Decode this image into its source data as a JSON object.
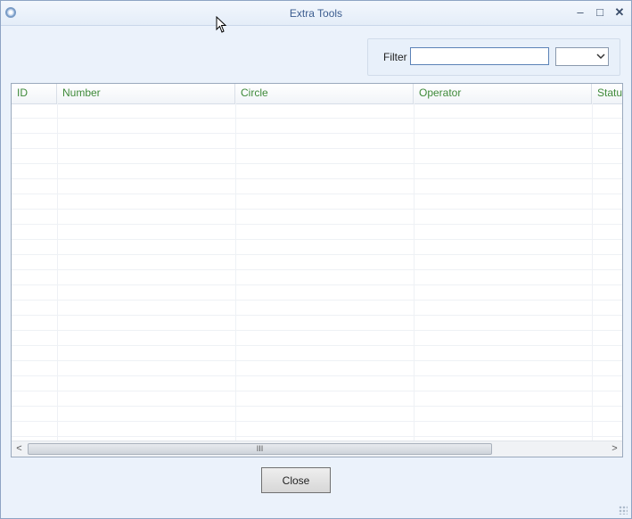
{
  "window": {
    "title": "Extra Tools",
    "minimize_glyph": "‒",
    "maximize_glyph": "□",
    "close_glyph": "✕"
  },
  "filter": {
    "label": "Filter",
    "input_value": "",
    "select_value": ""
  },
  "grid": {
    "columns": [
      "ID",
      "Number",
      "Circle",
      "Operator",
      "Status"
    ],
    "row_count_visible": 22,
    "scroll_left_glyph": "<",
    "scroll_right_glyph": ">",
    "scroll_thumb_grip": "III"
  },
  "footer": {
    "close_label": "Close"
  },
  "colors": {
    "header_text": "#3f8a3a",
    "title_text": "#3b5c8f",
    "window_bg": "#ebf2fb"
  }
}
